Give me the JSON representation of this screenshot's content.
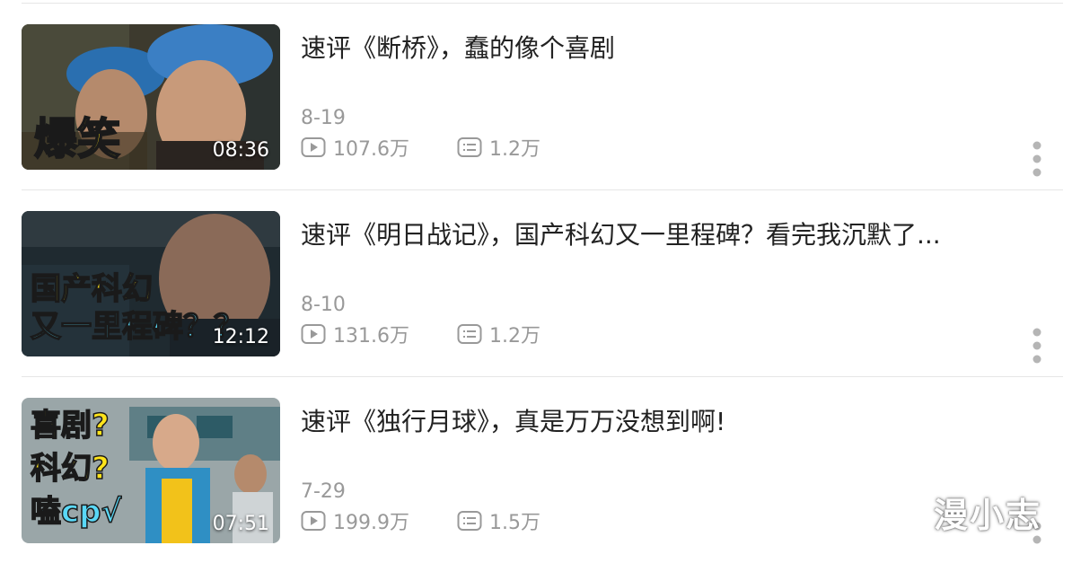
{
  "videos": [
    {
      "title": "速评《断桥》，蠢的像个喜剧",
      "overlay_text": "爆笑",
      "duration": "08:36",
      "date": "8-19",
      "views": "107.6万",
      "comments": "1.2万"
    },
    {
      "title": "速评《明日战记》，国产科幻又一里程碑？看完我沉默了...",
      "overlay_line1": "国产科幻",
      "overlay_line2": "又一里程碑？？",
      "duration": "12:12",
      "date": "8-10",
      "views": "131.6万",
      "comments": "1.2万"
    },
    {
      "title": "速评《独行月球》，真是万万没想到啊!",
      "overlay_line1": "喜剧?",
      "overlay_line2": "科幻?",
      "overlay_line3": "嗑cp√",
      "duration": "07:51",
      "date": "7-29",
      "views": "199.9万",
      "comments": "1.5万"
    }
  ],
  "icons": {
    "views": "play-icon",
    "comments": "comment-icon",
    "more": "more-vertical-icon"
  },
  "colors": {
    "title": "#222222",
    "meta": "#999999",
    "overlay_yellow": "#ffe41a",
    "overlay_cyan": "#59d8f7"
  },
  "watermark": "漫小志"
}
